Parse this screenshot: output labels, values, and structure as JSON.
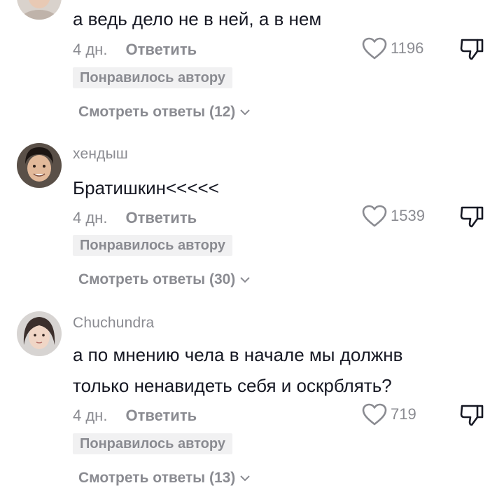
{
  "comments": [
    {
      "username": "",
      "lines": [
        "а ведь дело не в ней, а в нем"
      ],
      "time": "4 дн.",
      "reply_label": "Ответить",
      "likes": "1196",
      "badge": "Понравилось автору",
      "view_replies": "Смотреть ответы (12)"
    },
    {
      "username": "хендыш",
      "lines": [
        "Братишкин<<<<<"
      ],
      "time": "4 дн.",
      "reply_label": "Ответить",
      "likes": "1539",
      "badge": "Понравилось автору",
      "view_replies": "Смотреть ответы (30)"
    },
    {
      "username": "Chuchundra",
      "lines": [
        "а по мнению чела в начале мы должнв",
        "только ненавидеть себя и оскрблять?"
      ],
      "time": "4 дн.",
      "reply_label": "Ответить",
      "likes": "719",
      "badge": "Понравилось автору",
      "view_replies": "Смотреть ответы (13)"
    }
  ],
  "icons": {
    "like": "heart-outline-icon",
    "dislike": "thumbs-down-icon",
    "expand": "chevron-down-icon"
  },
  "colors": {
    "text": "#161823",
    "muted": "#8a8b91",
    "badge_bg": "#f1f1f2"
  }
}
